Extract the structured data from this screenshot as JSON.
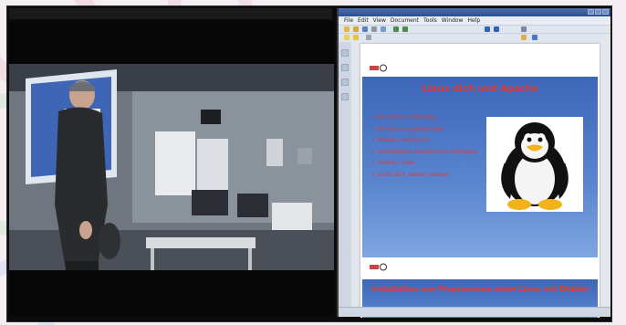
{
  "video": {
    "title": "",
    "description_hidden": ""
  },
  "app": {
    "menu": [
      "File",
      "Edit",
      "View",
      "Document",
      "Tools",
      "Window",
      "Help"
    ],
    "toolbar_icons": [
      "new-icon",
      "open-icon",
      "save-icon",
      "print-icon",
      "email-icon",
      "undo-icon",
      "redo-icon",
      "zoom-in-icon",
      "zoom-out-icon",
      "select-icon",
      "highlight-icon",
      "note-icon"
    ],
    "sidebar_icons": [
      "pages-icon",
      "bookmarks-icon",
      "attachments-icon",
      "comments-icon"
    ],
    "status_text": ""
  },
  "slides": [
    {
      "title": "Linux dich und Apache",
      "bullets": [
        "Ein dich zu Einstieg",
        "Ein dich zu group spar",
        "Debian versionen",
        "Installation, Konzert lich Software",
        "Debian Suse",
        "Dual dich anders Server"
      ]
    },
    {
      "title": "Installation von Programmen unter Linux mit Debian"
    }
  ],
  "colors": {
    "slide_bg": "#4f78c6",
    "slide_text": "#e23a2e",
    "title_bar": "#2d4f8f"
  }
}
